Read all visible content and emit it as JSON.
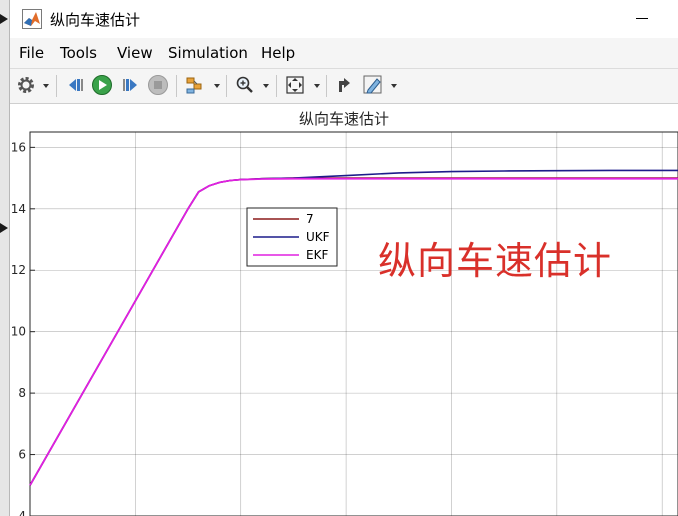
{
  "window": {
    "title": "纵向车速估计"
  },
  "menu": {
    "items": [
      {
        "key": "file",
        "label": "File"
      },
      {
        "key": "tools",
        "label": "Tools"
      },
      {
        "key": "view",
        "label": "View"
      },
      {
        "key": "simulation",
        "label": "Simulation"
      },
      {
        "key": "help",
        "label": "Help"
      }
    ]
  },
  "toolbar": {
    "icons": [
      "settings-gear-icon",
      "step-back-icon",
      "run-icon",
      "step-forward-icon",
      "stop-icon",
      "signal-selector-icon",
      "zoom-icon",
      "fit-to-view-icon",
      "style-icon",
      "edit-icon"
    ]
  },
  "colors": {
    "series_7": "#8b1a1a",
    "series_UKF": "#1c1c8a",
    "series_EKF": "#e020e0",
    "annotation": "#d9302a"
  },
  "annotation": {
    "text": "纵向车速估计"
  },
  "chart_data": {
    "type": "line",
    "title": "纵向车速估计",
    "xlabel": "",
    "ylabel": "",
    "ylim": [
      4,
      16.5
    ],
    "yticks": [
      4,
      6,
      8,
      10,
      12,
      14,
      16
    ],
    "xlim": [
      0,
      6.15
    ],
    "grid": true,
    "legend_placement": "upper-left-inner",
    "series": [
      {
        "name": "7",
        "color": "#8b1a1a",
        "x": [
          0,
          1.5,
          1.6,
          1.7,
          1.8,
          1.9,
          2.0,
          2.2,
          2.5,
          3.0,
          3.5,
          4.0,
          4.5,
          5.0,
          5.5,
          6.15
        ],
        "y": [
          5.0,
          14.0,
          14.55,
          14.75,
          14.86,
          14.92,
          14.95,
          14.98,
          15.0,
          15.0,
          15.0,
          15.0,
          15.0,
          15.0,
          15.0,
          15.0
        ]
      },
      {
        "name": "UKF",
        "color": "#1c1c8a",
        "x": [
          0,
          1.5,
          1.6,
          1.7,
          1.8,
          1.9,
          2.0,
          2.2,
          2.5,
          3.0,
          3.5,
          4.0,
          4.5,
          5.0,
          5.5,
          6.15
        ],
        "y": [
          5.0,
          14.0,
          14.55,
          14.75,
          14.86,
          14.92,
          14.95,
          14.98,
          15.0,
          15.08,
          15.17,
          15.21,
          15.23,
          15.24,
          15.25,
          15.25
        ]
      },
      {
        "name": "EKF",
        "color": "#e020e0",
        "x": [
          0,
          1.5,
          1.6,
          1.7,
          1.8,
          1.9,
          2.0,
          2.2,
          2.5,
          3.0,
          3.5,
          4.0,
          4.5,
          5.0,
          5.5,
          6.15
        ],
        "y": [
          5.0,
          14.0,
          14.55,
          14.75,
          14.86,
          14.92,
          14.95,
          14.97,
          14.98,
          14.98,
          14.98,
          14.98,
          14.98,
          14.98,
          14.98,
          14.98
        ]
      }
    ]
  }
}
